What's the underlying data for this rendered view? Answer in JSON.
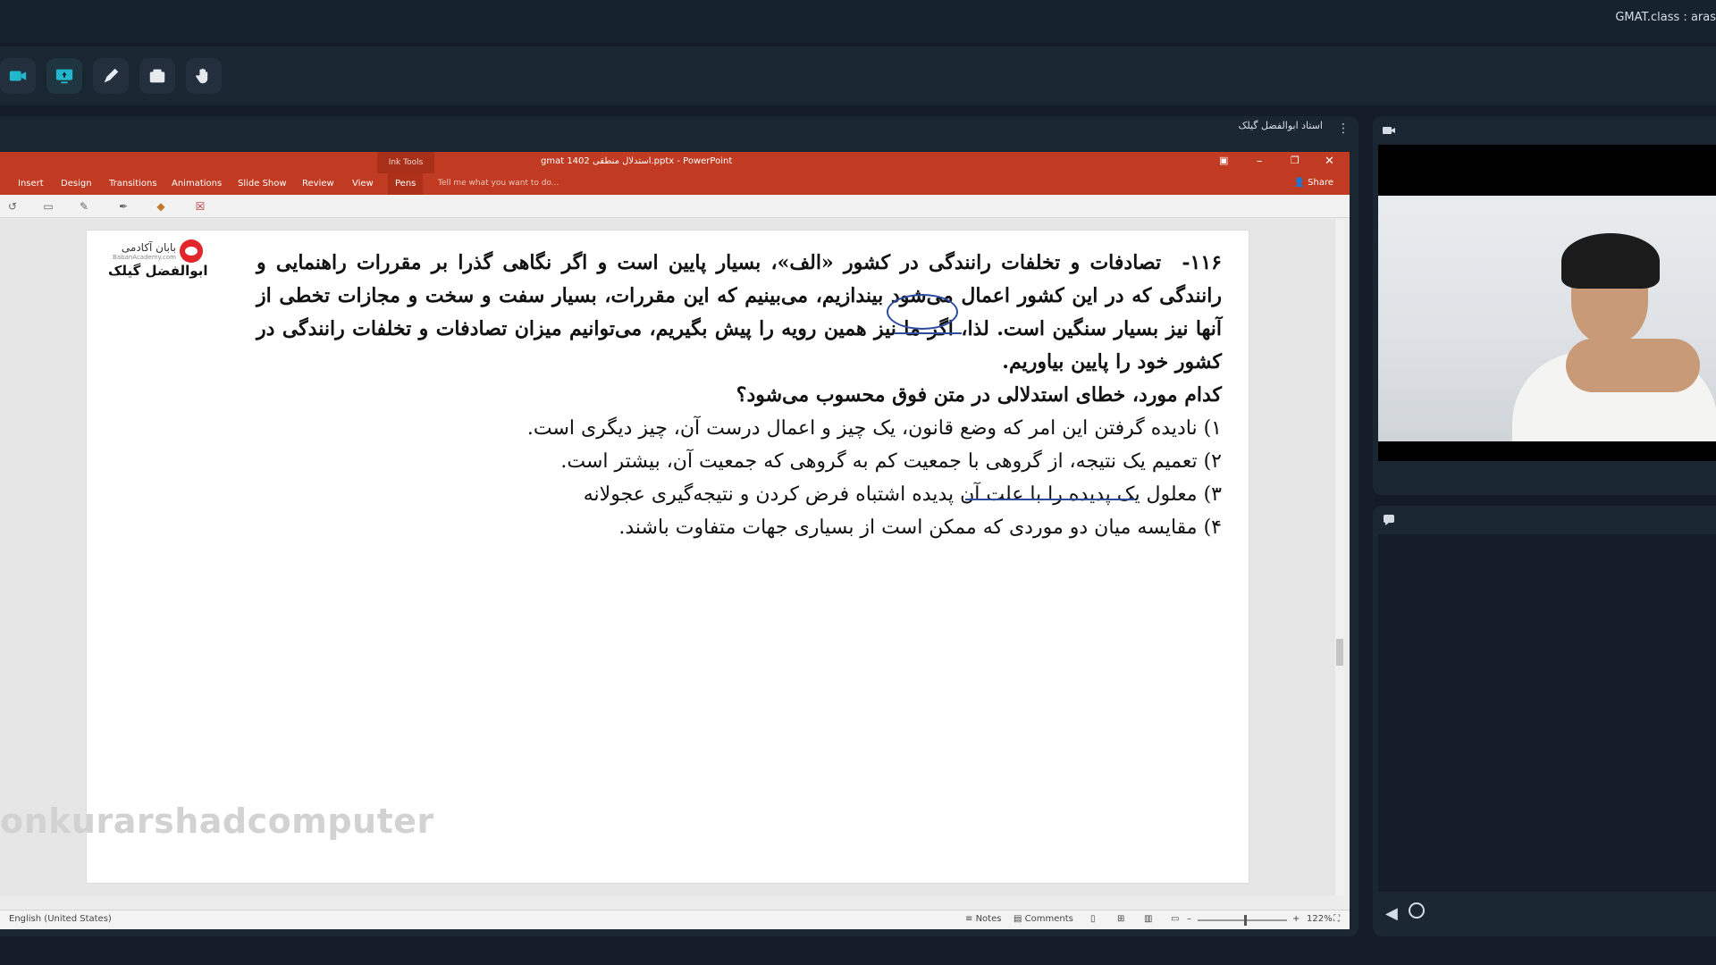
{
  "app": {
    "title": "GMAT.class : aras"
  },
  "toolbar": {
    "buttons": [
      {
        "name": "camera-button",
        "icon": "camera-icon"
      },
      {
        "name": "screen-share-button",
        "icon": "screen-share-icon"
      },
      {
        "name": "pen-button",
        "icon": "pen-icon"
      },
      {
        "name": "whiteboard-button",
        "icon": "folder-icon"
      },
      {
        "name": "raise-hand-button",
        "icon": "hand-icon"
      }
    ],
    "accent": "#1fb8cc"
  },
  "share": {
    "presenter_label": "استاد ابوالفضل گیلک"
  },
  "powerpoint": {
    "doc_title": "gmat 1402 استدلال منطقی.pptx - PowerPoint",
    "ink_tools": "Ink Tools",
    "tabs": [
      "Insert",
      "Design",
      "Transitions",
      "Animations",
      "Slide Show",
      "Review",
      "View",
      "Pens"
    ],
    "active_tab": "Pens",
    "tell_me": "Tell me what you want to do...",
    "share": "Share",
    "title_bar_color": "#c13b22",
    "status": {
      "language": "English (United States)",
      "notes": "Notes",
      "comments": "Comments",
      "zoom": "122%"
    }
  },
  "slide": {
    "logo_text": "بابان آکادمی",
    "logo_sub": "BabanAcademy.com",
    "author": "ابوالفضل گیلک",
    "question_number": "۱۱۶-",
    "question_text": "تصادفات و تخلفات رانندگی در کشور «الف»، بسیار پایین است و اگر نگاهی گذرا بر مقررات راهنمایی و رانندگی که در این کشور اعمال می‌شود بیندازیم، می‌بینیم که این مقررات، بسیار سفت و سخت و مجازات تخطی از آنها نیز بسیار سنگین است. لذا، اگر ما نیز همین رویه را پیش بگیریم، می‌توانیم میزان تصادفات و تخلفات رانندگی در کشور خود را پایین بیاوریم.",
    "prompt": "کدام مورد، خطای استدلالی در متن فوق محسوب می‌شود؟",
    "options": [
      "۱) نادیده گرفتن این امر که وضع قانون، یک چیز و اعمال درست آن، چیز دیگری است.",
      "۲) تعمیم یک نتیجه، از گروهی با جمعیت کم به گروهی که جمعیت آن، بیشتر است.",
      "۳) معلول یک پدیده را با علت آن پدیده اشتباه فرض کردن و نتیجه‌گیری عجولانه",
      "۴) مقایسه میان دو موردی که ممکن است از بسیاری جهات متفاوت باشند."
    ],
    "watermark": "onkurarshadcomputer",
    "ink_color": "#2e4c9e"
  },
  "video": {
    "icon": "video-camera-icon"
  },
  "chat": {
    "icon": "chat-icon",
    "send_icon": "send-icon",
    "emoji_icon": "emoji-icon"
  }
}
